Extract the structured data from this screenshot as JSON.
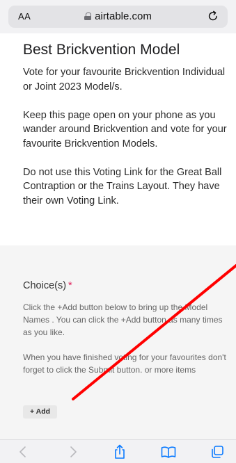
{
  "browser": {
    "text_size_label": "AA",
    "url": "airtable.com",
    "icons": {
      "lock": "lock-icon",
      "reload": "reload-icon",
      "back": "back-chevron-icon",
      "forward": "forward-chevron-icon",
      "share": "share-icon",
      "bookmarks": "bookmarks-icon",
      "tabs": "tabs-icon"
    },
    "accent_color": "#0a7aff"
  },
  "form": {
    "title": "Best Brickvention Model",
    "description": [
      "Vote for your favourite Brickvention Individual or Joint 2023 Model/s.",
      "Keep this page open on your phone as you wander around Brickvention and vote for your favourite Brickvention Models.",
      "Do not use this Voting Link for the Great Ball Contraption or the Trains Layout. They have their own Voting Link."
    ],
    "field": {
      "label": "Choice(s)",
      "required_mark": "*",
      "help": [
        "Click the +Add button below to bring up the Model Names .  You can click the +Add button as many times as you like.",
        "When you have finished voting for your favourites don't forget to click the Submit button. or more items"
      ],
      "add_button_label": "+ Add"
    },
    "required_color": "#e0245e"
  },
  "annotation": {
    "color": "#ff0000"
  }
}
